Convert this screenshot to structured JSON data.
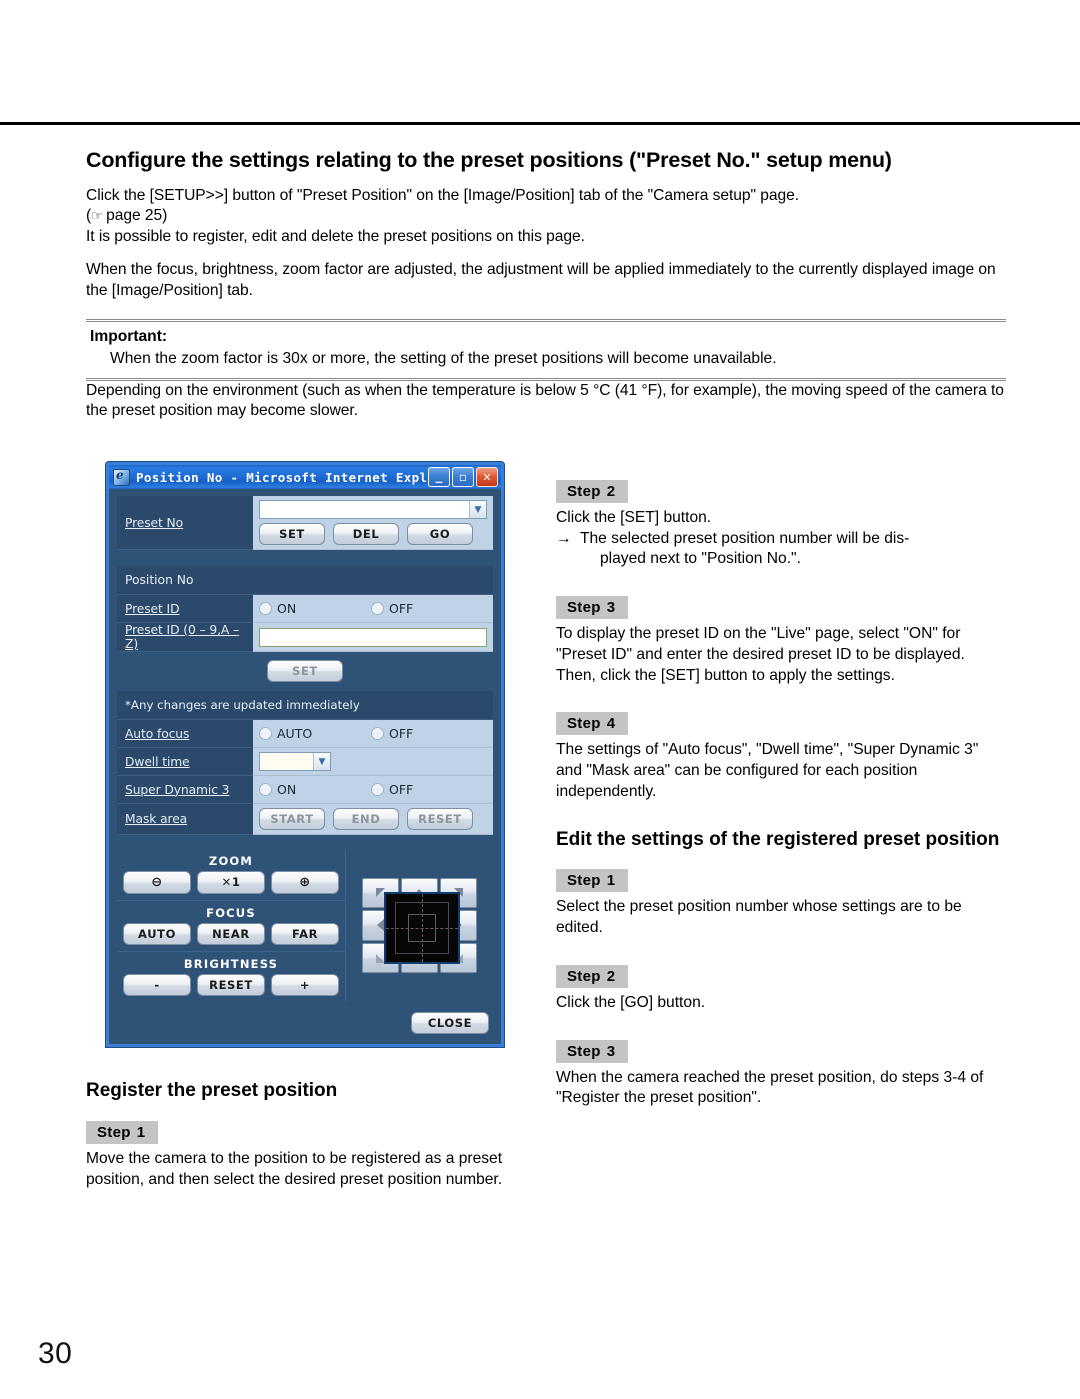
{
  "page": {
    "number": "30"
  },
  "section": {
    "title": "Configure the settings relating to the preset positions (\"Preset No.\" setup menu)",
    "para1": "Click the [SETUP>>] button of \"Preset Position\" on the [Image/Position] tab of the \"Camera setup\" page.",
    "para2_prefix": "(",
    "para2_icon": "☞",
    "para2_text": " page 25)",
    "para3": "It is possible to register, edit and delete the preset positions on this page.",
    "para4": "When the focus, brightness, zoom factor are adjusted, the adjustment will be applied immediately to the currently displayed image on the [Image/Position] tab.",
    "important_label": "Important:",
    "important_body": "When the zoom factor is 30x or more, the setting of the preset positions will become unavailable.",
    "para5": "Depending on the environment (such as when the temperature is below 5 °C (41 °F), for example), the moving speed of the camera to the preset position may become slower."
  },
  "dialog": {
    "title": "Position No - Microsoft Internet Explorer",
    "window_buttons": {
      "minimize": "_",
      "maximize": "▫",
      "close": "✕"
    },
    "rows": {
      "preset_no_label": "Preset No",
      "preset_no_value": "",
      "set_label": "SET",
      "del_label": "DEL",
      "go_label": "GO",
      "position_no_label": "Position No",
      "preset_id_label": "Preset ID",
      "preset_id_on": "ON",
      "preset_id_off": "OFF",
      "preset_id_range_label": "Preset ID (0 – 9,A – Z)",
      "preset_id_value": "",
      "set2_label": "SET",
      "note": "*Any changes are updated immediately",
      "auto_focus_label": "Auto focus",
      "auto_focus_auto": "AUTO",
      "auto_focus_off": "OFF",
      "dwell_time_label": "Dwell time",
      "dwell_time_value": "",
      "super_dynamic_label": "Super Dynamic 3",
      "super_dynamic_on": "ON",
      "super_dynamic_off": "OFF",
      "mask_area_label": "Mask area",
      "mask_start": "START",
      "mask_end": "END",
      "mask_reset": "RESET"
    },
    "controls": {
      "zoom_caption": "ZOOM",
      "zoom_out": "⊖",
      "zoom_x1": "✕1",
      "zoom_in": "⊕",
      "focus_caption": "FOCUS",
      "focus_auto": "AUTO",
      "focus_near": "NEAR",
      "focus_far": "FAR",
      "brightness_caption": "BRIGHTNESS",
      "brightness_minus": "-",
      "brightness_reset": "RESET",
      "brightness_plus": "+",
      "close_label": "CLOSE"
    }
  },
  "steps_right_top": [
    {
      "badge": "Step",
      "num": "2",
      "line1": "Click the [SET] button.",
      "arrow": "→",
      "arrow_text": "The selected preset position number will be dis-",
      "arrow_cont": "played next to \"Position No.\"."
    },
    {
      "badge": "Step",
      "num": "3",
      "body": "To display the preset ID on the \"Live\" page, select \"ON\" for \"Preset ID\" and enter the desired preset ID to be displayed. Then, click the [SET] button to apply the settings."
    },
    {
      "badge": "Step",
      "num": "4",
      "body": "The settings of \"Auto focus\", \"Dwell time\", \"Super Dynamic 3\" and \"Mask area\" can be configured for each position independently."
    }
  ],
  "edit_section": {
    "title": "Edit the settings of the registered preset position",
    "steps": [
      {
        "badge": "Step",
        "num": "1",
        "body": "Select the preset position number whose settings are to be edited."
      },
      {
        "badge": "Step",
        "num": "2",
        "body": "Click the [GO] button."
      },
      {
        "badge": "Step",
        "num": "3",
        "body": "When the camera reached the preset position, do steps 3-4 of \"Register the preset position\"."
      }
    ]
  },
  "register_section": {
    "title": "Register the preset position",
    "steps": [
      {
        "badge": "Step",
        "num": "1",
        "body": "Move the camera to the position to be registered as a preset position, and then select the desired preset position number."
      }
    ]
  }
}
